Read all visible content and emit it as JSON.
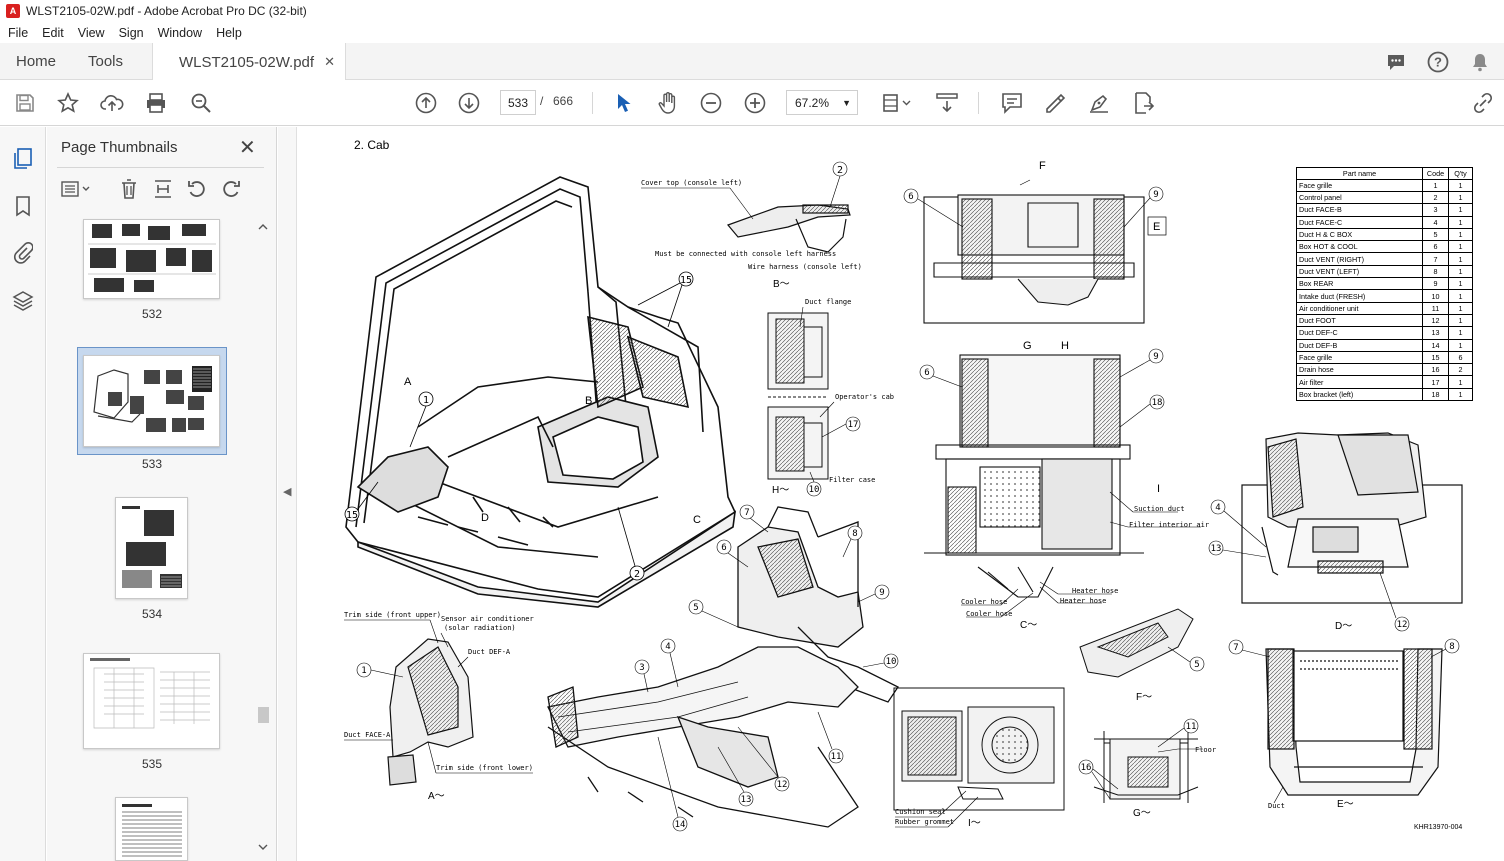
{
  "window": {
    "title": "WLST2105-02W.pdf - Adobe Acrobat Pro DC (32-bit)",
    "app_icon_text": "A",
    "minimize": "—",
    "maximize": "☐",
    "close": "✕"
  },
  "menu": [
    "File",
    "Edit",
    "View",
    "Sign",
    "Window",
    "Help"
  ],
  "tabs": {
    "home": "Home",
    "tools": "Tools",
    "document": "WLST2105-02W.pdf",
    "close": "✕"
  },
  "toolbar": {
    "current_page": "533",
    "page_separator": "/",
    "total_pages": "666",
    "zoom": "67.2%"
  },
  "thumbnails": {
    "title": "Page Thumbnails",
    "close": "✕",
    "pages": [
      "532",
      "533",
      "534",
      "535"
    ]
  },
  "document": {
    "section_title": "2. Cab",
    "figure_code": "KHR13970-004",
    "parts_table": {
      "headers": [
        "Part name",
        "Code",
        "Q'ty"
      ],
      "rows": [
        [
          "Face grille",
          "1",
          "1"
        ],
        [
          "Control panel",
          "2",
          "1"
        ],
        [
          "Duct FACE-B",
          "3",
          "1"
        ],
        [
          "Duct FACE-C",
          "4",
          "1"
        ],
        [
          "Duct H & C BOX",
          "5",
          "1"
        ],
        [
          "Box HOT & COOL",
          "6",
          "1"
        ],
        [
          "Duct VENT (RIGHT)",
          "7",
          "1"
        ],
        [
          "Duct VENT (LEFT)",
          "8",
          "1"
        ],
        [
          "Box REAR",
          "9",
          "1"
        ],
        [
          "Intake duct (FRESH)",
          "10",
          "1"
        ],
        [
          "Air conditioner unit",
          "11",
          "1"
        ],
        [
          "Duct FOOT",
          "12",
          "1"
        ],
        [
          "Duct DEF-C",
          "13",
          "1"
        ],
        [
          "Duct DEF-B",
          "14",
          "1"
        ],
        [
          "Face grille",
          "15",
          "6"
        ],
        [
          "Drain hose",
          "16",
          "2"
        ],
        [
          "Air filter",
          "17",
          "1"
        ],
        [
          "Box bracket (left)",
          "18",
          "1"
        ]
      ]
    },
    "callouts": {
      "cover_top": "Cover  top (console left)",
      "must_connect": "Must be connected with console left harness",
      "wire_harness": "Wire harness (console left)",
      "duct_flange": "Duct flange",
      "operators_cab": "Operator's cab",
      "filter_case": "Filter case",
      "suction_duct": "Suction duct",
      "filter_interior": "Filter  interior air",
      "heater_hose_1": "Heater hose",
      "heater_hose_2": "Heater hose",
      "cooler_hose_1": "Cooler hose",
      "cooler_hose_2": "Cooler hose",
      "trim_front_upper": "Trim  side (front upper)",
      "sensor_line1": "Sensor  air conditioner",
      "sensor_line2": "(solar radiation)",
      "duct_def_a": "Duct  DEF-A",
      "duct_face_a": "Duct  FACE-A",
      "trim_front_lower": "Trim  side (front lower)",
      "floor": "Floor",
      "cushion_seal": "Cushion seal",
      "rubber_grommet": "Rubber grommet",
      "duct": "Duct"
    },
    "view_labels": {
      "a": "A～",
      "b": "B～",
      "c": "C～",
      "d": "D～",
      "e": "E～",
      "f": "F～",
      "g": "G～",
      "h": "H～",
      "i": "I～",
      "marker_A": "A",
      "marker_B": "B",
      "marker_C": "C",
      "marker_D": "D",
      "marker_E": "E",
      "marker_F": "F",
      "marker_G": "G",
      "marker_H": "H",
      "marker_I": "I"
    }
  }
}
